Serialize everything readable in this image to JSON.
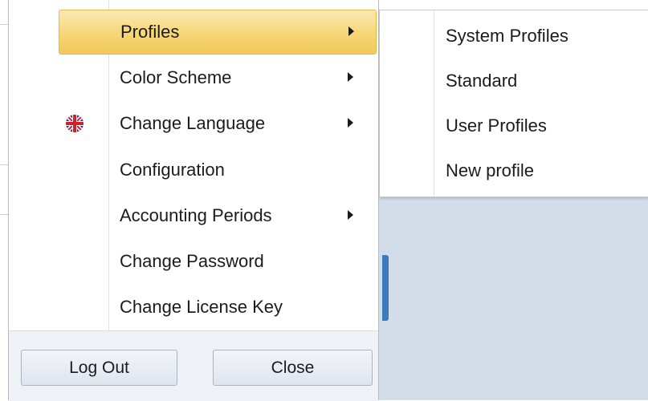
{
  "menu": {
    "items": [
      {
        "label": "Profiles",
        "has_submenu": true,
        "highlighted": true
      },
      {
        "label": "Color Scheme",
        "has_submenu": true
      },
      {
        "label": "Change Language",
        "has_submenu": true,
        "icon": "uk-flag-icon"
      },
      {
        "label": "Configuration",
        "has_submenu": false
      },
      {
        "label": "Accounting Periods",
        "has_submenu": true
      },
      {
        "label": "Change Password",
        "has_submenu": false
      },
      {
        "label": "Change License Key",
        "has_submenu": false
      }
    ]
  },
  "footer": {
    "logout_label": "Log Out",
    "close_label": "Close"
  },
  "submenu": {
    "items": [
      {
        "label": "System Profiles"
      },
      {
        "label": "Standard"
      },
      {
        "label": "User Profiles"
      },
      {
        "label": "New profile"
      }
    ]
  },
  "colors": {
    "highlight": "#f6d675",
    "background_panel": "#d3dde9",
    "accent_tab": "#3d7bbd"
  }
}
